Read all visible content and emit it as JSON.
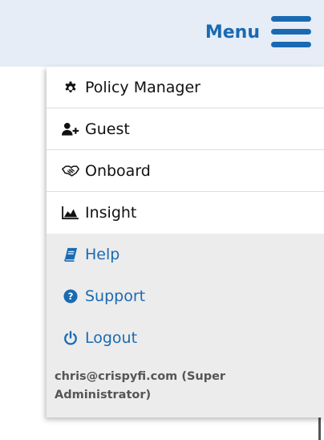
{
  "header": {
    "menu_label": "Menu"
  },
  "menu": {
    "items": [
      {
        "label": "Policy Manager",
        "icon": "gear-icon"
      },
      {
        "label": "Guest",
        "icon": "add-user-icon"
      },
      {
        "label": "Onboard",
        "icon": "handshake-icon"
      },
      {
        "label": "Insight",
        "icon": "area-chart-icon"
      }
    ],
    "secondary_items": [
      {
        "label": "Help",
        "icon": "book-icon"
      },
      {
        "label": "Support",
        "icon": "question-circle-icon"
      },
      {
        "label": "Logout",
        "icon": "power-icon"
      }
    ],
    "user": "chris@crispyfi.com (Super Administrator)"
  },
  "colors": {
    "accent": "#1a6ab3",
    "topbar_bg": "#e6edf6",
    "grey_section_bg": "#ececec"
  }
}
